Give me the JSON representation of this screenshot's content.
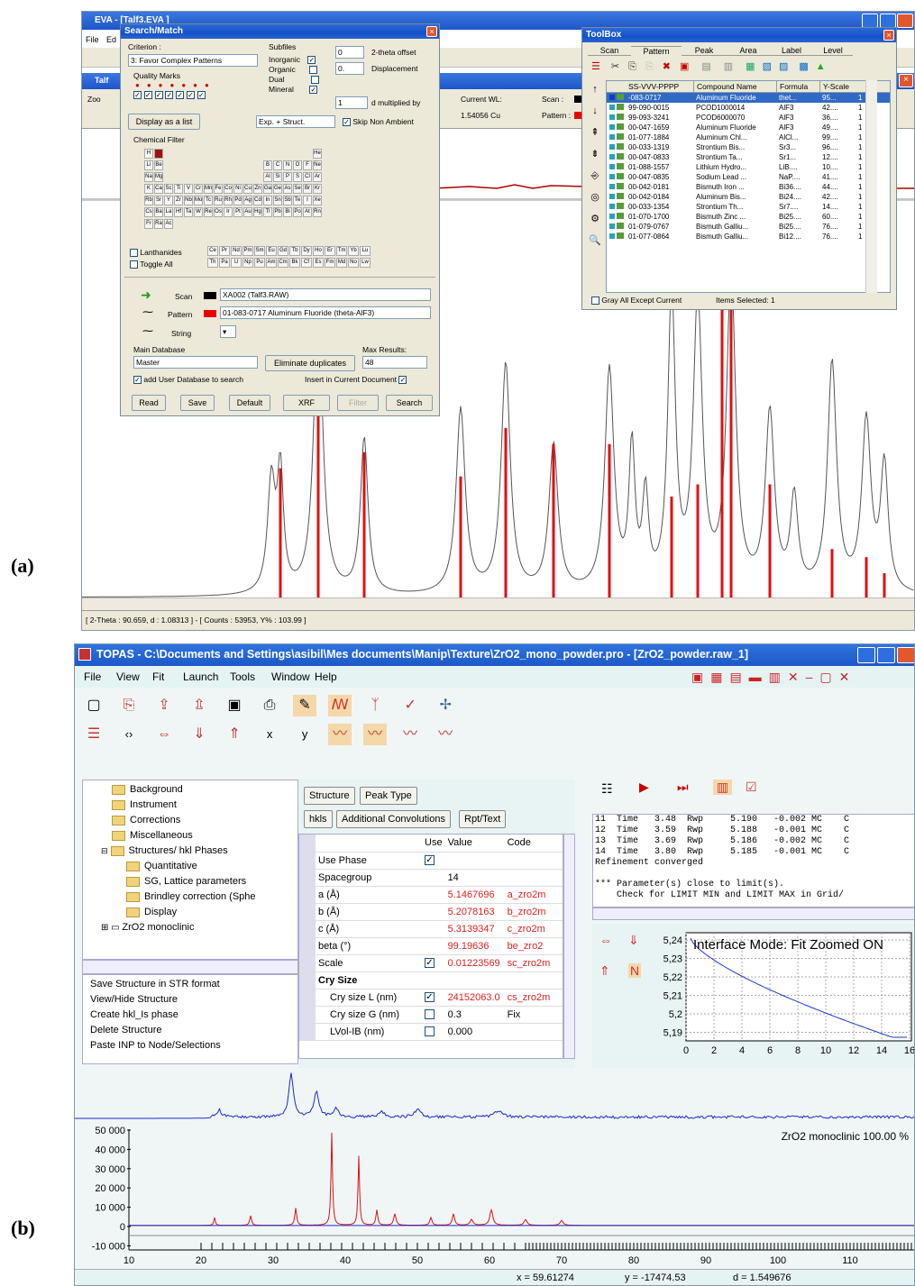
{
  "labels": {
    "a": "(a)",
    "b": "(b)"
  },
  "eva": {
    "title": "EVA - [Talf3.EVA ]",
    "menu": [
      "File",
      "Ed"
    ],
    "status": "[ 2-Theta : 90.659, d : 1.08313 ] - [ Counts : 53953, Y% : 103.99 ]",
    "current_wl_label": "Current WL:",
    "current_wl": "1.54056 Cu",
    "scan_label": "Scan :",
    "pattern_label": "Pattern :",
    "zoom_label": "Zoo",
    "search_match": {
      "title": "Search/Match",
      "criterion_label": "Criterion :",
      "criterion": "3: Favor Complex Patterns",
      "quality_label": "Quality Marks",
      "subfiles_label": "Subfiles",
      "subfiles": [
        "Inorganic",
        "Organic",
        "Dual",
        "Mineral"
      ],
      "offset_value": "0",
      "offset_label": "2-theta offset",
      "disp_value": "0.",
      "disp_label": "Displacement",
      "dmult_value": "1",
      "dmult_label": "d multiplied by",
      "display_list": "Display as a list",
      "exp_struct": "Exp. + Struct.",
      "skip_label": "Skip Non Ambient",
      "chem_filter": "Chemical Filter",
      "elements": [
        [
          "H",
          "",
          "",
          "",
          "",
          "",
          "",
          "",
          "",
          "",
          "",
          "",
          "",
          "",
          "",
          "",
          "",
          "He"
        ],
        [
          "Li",
          "Be",
          "",
          "",
          "",
          "",
          "",
          "",
          "",
          "",
          "",
          "",
          "B",
          "C",
          "N",
          "O",
          "F",
          "Ne"
        ],
        [
          "Na",
          "Mg",
          "",
          "",
          "",
          "",
          "",
          "",
          "",
          "",
          "",
          "",
          "Al",
          "Si",
          "P",
          "S",
          "Cl",
          "Ar"
        ],
        [
          "K",
          "Ca",
          "Sc",
          "Ti",
          "V",
          "Cr",
          "Mn",
          "Fe",
          "Co",
          "Ni",
          "Cu",
          "Zn",
          "Ga",
          "Ge",
          "As",
          "Se",
          "Br",
          "Kr"
        ],
        [
          "Rb",
          "Sr",
          "Y",
          "Zr",
          "Nb",
          "Mo",
          "Tc",
          "Ru",
          "Rh",
          "Pd",
          "Ag",
          "Cd",
          "In",
          "Sn",
          "Sb",
          "Te",
          "I",
          "Xe"
        ],
        [
          "Cs",
          "Ba",
          "La",
          "Hf",
          "Ta",
          "W",
          "Re",
          "Os",
          "Ir",
          "Pt",
          "Au",
          "Hg",
          "Tl",
          "Pb",
          "Bi",
          "Po",
          "At",
          "Rn"
        ],
        [
          "Fr",
          "Ra",
          "Ac",
          "",
          "",
          "",
          "",
          "",
          "",
          "",
          "",
          "",
          "",
          "",
          "",
          "",
          "",
          ""
        ]
      ],
      "lanthanides_label": "Lanthanides",
      "toggle_label": "Toggle All",
      "lanth": [
        "Ce",
        "Pr",
        "Nd",
        "Pm",
        "Sm",
        "Eu",
        "Gd",
        "Tb",
        "Dy",
        "Ho",
        "Er",
        "Tm",
        "Yb",
        "Lu"
      ],
      "actin": [
        "Th",
        "Pa",
        "U",
        "Np",
        "Pu",
        "Am",
        "Cm",
        "Bk",
        "Cf",
        "Es",
        "Fm",
        "Md",
        "No",
        "Lw"
      ],
      "scan_row_label": "Scan",
      "scan_row_value": "XA002 (Talf3.RAW)",
      "pattern_row_label": "Pattern",
      "pattern_row_value": "01-083-0717 Aluminum Fluoride (theta-AlF3)",
      "string_label": "String",
      "main_db_label": "Main Database",
      "main_db": "Master",
      "eliminate": "Eliminate duplicates",
      "max_results_label": "Max Results:",
      "max_results": "48",
      "add_user_db": "add User Database to search",
      "insert_current": "Insert in Current Document",
      "buttons": [
        "Read",
        "Save",
        "Default",
        "XRF",
        "Filter",
        "Search"
      ]
    },
    "toolbox": {
      "title": "ToolBox",
      "tabs": [
        "Scan",
        "Pattern",
        "Peak",
        "Area",
        "Label",
        "Level"
      ],
      "columns": [
        "SS-VVV-PPPP",
        "Compound Name",
        "Formula",
        "Y-Scale"
      ],
      "rows": [
        [
          "-083-0717",
          "Aluminum Fluoride",
          "thet...",
          "95...",
          "1"
        ],
        [
          "99-090-0015",
          "PCOD1000014",
          "AlF3",
          "42....",
          "1"
        ],
        [
          "99-093-3241",
          "PCOD6000070",
          "AlF3",
          "36....",
          "1"
        ],
        [
          "00-047-1659",
          "Aluminum Fluoride",
          "AlF3",
          "49....",
          "1"
        ],
        [
          "01-077-1884",
          "Aluminum Chl...",
          "AlCl...",
          "99....",
          "1"
        ],
        [
          "00-033-1319",
          "Strontium Bis...",
          "Sr3...",
          "96....",
          "1"
        ],
        [
          "00-047-0833",
          "Strontium Ta...",
          "Sr1...",
          "12....",
          "1"
        ],
        [
          "01-088-1557",
          "Lithium Hydro...",
          "LiB....",
          "10....",
          "1"
        ],
        [
          "00-047-0835",
          "Sodium Lead ...",
          "NaP....",
          "41....",
          "1"
        ],
        [
          "00-042-0181",
          "Bismuth Iron ...",
          "Bi36....",
          "44....",
          "1"
        ],
        [
          "00-042-0184",
          "Aluminum Bis...",
          "Bi24....",
          "42....",
          "1"
        ],
        [
          "00-033-1354",
          "Strontium Th...",
          "Sr7....",
          "14....",
          "1"
        ],
        [
          "01-070-1700",
          "Bismuth Zinc ...",
          "Bi25....",
          "60....",
          "1"
        ],
        [
          "01-079-0767",
          "Bismuth Galliu...",
          "Bi25....",
          "76....",
          "1"
        ],
        [
          "01-077-0864",
          "Bismuth Galliu...",
          "Bi12....",
          "76....",
          "1"
        ]
      ],
      "gray_all": "Gray All Except Current",
      "items_selected": "Items Selected: 1"
    }
  },
  "topas": {
    "title": "TOPAS - C:\\Documents and Settings\\asibil\\Mes documents\\Manip\\Texture\\ZrO2_mono_powder.pro - [ZrO2_powder.raw_1]",
    "menu": [
      "File",
      "View",
      "Fit",
      "Launch",
      "Tools",
      "Window",
      "Help"
    ],
    "toolbar2_text": [
      "x",
      "y"
    ],
    "tree": [
      {
        "label": "Background",
        "indent": 2
      },
      {
        "label": "Instrument",
        "indent": 2
      },
      {
        "label": "Corrections",
        "indent": 2
      },
      {
        "label": "Miscellaneous",
        "indent": 2
      },
      {
        "label": "Structures/ hkl Phases",
        "indent": 1
      },
      {
        "label": "Quantitative",
        "indent": 3
      },
      {
        "label": "SG, Lattice parameters",
        "indent": 3
      },
      {
        "label": "Brindley correction (Sphe",
        "indent": 3
      },
      {
        "label": "Display",
        "indent": 3
      },
      {
        "label": "ZrO2 monoclinic",
        "indent": 1
      }
    ],
    "actions": [
      "Save Structure in STR format",
      "View/Hide Structure",
      "Create hkl_Is phase",
      "Delete Structure",
      "Paste INP to Node/Selections"
    ],
    "buttons": [
      "Structure",
      "Peak Type",
      "hkls",
      "Additional Convolutions",
      "Rpt/Text"
    ],
    "table_headers": [
      "Use",
      "Value",
      "Code"
    ],
    "table": [
      {
        "name": "Use Phase",
        "use": true,
        "value": "",
        "code": "",
        "red": false,
        "bold": false,
        "indent": false
      },
      {
        "name": "Spacegroup",
        "use": null,
        "value": "14",
        "code": "",
        "red": false,
        "bold": false,
        "indent": false
      },
      {
        "name": "a (Å)",
        "use": null,
        "value": "5.1467696",
        "code": "a_zro2m",
        "red": true,
        "bold": false,
        "indent": false
      },
      {
        "name": "b (Å)",
        "use": null,
        "value": "5.2078163",
        "code": "b_zro2m",
        "red": true,
        "bold": false,
        "indent": false
      },
      {
        "name": "c (Å)",
        "use": null,
        "value": "5.3139347",
        "code": "c_zro2m",
        "red": true,
        "bold": false,
        "indent": false
      },
      {
        "name": "beta (°)",
        "use": null,
        "value": "99.19636",
        "code": "be_zro2",
        "red": true,
        "bold": false,
        "indent": false
      },
      {
        "name": "Scale",
        "use": true,
        "value": "0.01223569",
        "code": "sc_zro2m",
        "red": true,
        "bold": false,
        "indent": false
      },
      {
        "name": "Cry Size",
        "use": null,
        "value": "",
        "code": "",
        "red": false,
        "bold": true,
        "indent": false
      },
      {
        "name": "Cry size L (nm)",
        "use": true,
        "value": "24152063.0",
        "code": "cs_zro2m",
        "red": true,
        "bold": false,
        "indent": true
      },
      {
        "name": "Cry size G (nm)",
        "use": false,
        "value": "0.3",
        "code": "Fix",
        "red": false,
        "bold": false,
        "indent": true
      },
      {
        "name": "LVol-IB (nm)",
        "use": false,
        "value": "0.000",
        "code": "",
        "red": false,
        "bold": false,
        "indent": true
      }
    ],
    "log": [
      "11  Time   3.48  Rwp     5.190   -0.002 MC    C",
      "12  Time   3.59  Rwp     5.188   -0.001 MC    C",
      "13  Time   3.69  Rwp     5.186   -0.002 MC    C",
      "14  Time   3.80  Rwp     5.185   -0.001 MC    C",
      "Refinement converged",
      "",
      "*** Parameter(s) close to limit(s).",
      "    Check for LIMIT MIN and LIMIT MAX in Grid/"
    ],
    "mini_chart": {
      "title": "Interface Mode: Fit Zoomed ON",
      "yticks": [
        "5,24",
        "5,23",
        "5,22",
        "5,21",
        "5,2",
        "5,19"
      ],
      "xticks": [
        "0",
        "2",
        "4",
        "6",
        "8",
        "10",
        "12",
        "14",
        "16"
      ]
    },
    "main_chart": {
      "phase_label": "ZrO2 monoclinic  100.00 %",
      "yticks": [
        "50 000",
        "40 000",
        "30 000",
        "20 000",
        "10 000",
        "0",
        "-10 000"
      ],
      "xticks": [
        "10",
        "20",
        "30",
        "40",
        "50",
        "60",
        "70",
        "80",
        "90",
        "100",
        "110"
      ]
    },
    "status": {
      "x": "x = 59.61274",
      "y": "y = -17474.53",
      "d": "d = 1.549676"
    }
  }
}
